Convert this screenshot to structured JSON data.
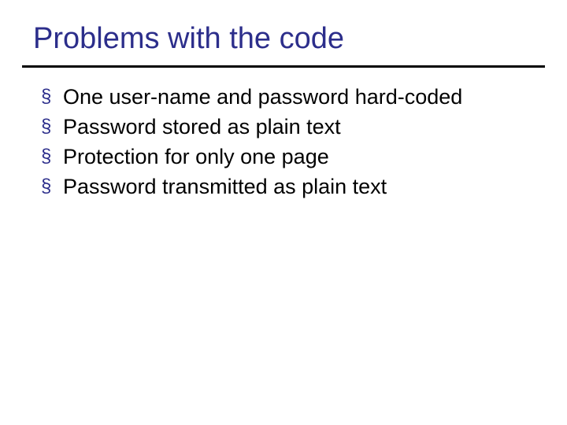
{
  "title": "Problems with the code",
  "bullets": [
    "One user-name and password hard-coded",
    "Password stored as plain text",
    "Protection for only one page",
    "Password transmitted as plain text"
  ],
  "bullet_glyph": "§"
}
